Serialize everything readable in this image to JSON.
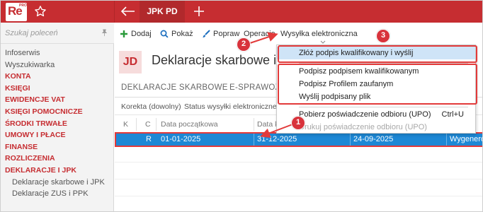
{
  "app": {
    "logo_text": "Re",
    "logo_badge": "PRO",
    "active_tab": "JPK PD"
  },
  "sidebar": {
    "search_placeholder": "Szukaj poleceń",
    "items": [
      {
        "label": "Infoserwis",
        "kind": "plain"
      },
      {
        "label": "Wyszukiwarka",
        "kind": "plain"
      },
      {
        "label": "KONTA",
        "kind": "cat"
      },
      {
        "label": "KSIĘGI",
        "kind": "cat"
      },
      {
        "label": "EWIDENCJE VAT",
        "kind": "cat"
      },
      {
        "label": "KSIĘGI POMOCNICZE",
        "kind": "cat"
      },
      {
        "label": "ŚRODKI TRWAŁE",
        "kind": "cat"
      },
      {
        "label": "UMOWY I PŁACE",
        "kind": "cat"
      },
      {
        "label": "FINANSE",
        "kind": "cat"
      },
      {
        "label": "ROZLICZENIA",
        "kind": "cat"
      },
      {
        "label": "DEKLARACJE I JPK",
        "kind": "cat"
      },
      {
        "label": "Deklaracje skarbowe i JPK",
        "kind": "sub"
      },
      {
        "label": "Deklaracje ZUS i PPK",
        "kind": "sub"
      }
    ]
  },
  "toolbar": {
    "add": "Dodaj",
    "show": "Pokaż",
    "fix": "Popraw",
    "operations": "Operacje",
    "eshipping": "Wysyłka elektroniczna"
  },
  "module": {
    "badge": "JD",
    "title": "Deklaracje skarbowe i JPK",
    "subtabs": [
      "DEKLARACJE SKARBOWE",
      "E-SPRAWOZDANIA"
    ],
    "filters": [
      "Korekta (dowolny)",
      "Status wysyłki elektronicznej"
    ]
  },
  "grid": {
    "columns": [
      "K",
      "C",
      "Data początkowa",
      "Data końcowa"
    ],
    "row": {
      "k": "",
      "c": "R",
      "date_from": "01-01-2025",
      "date_to": "31-12-2025",
      "date_created": "24-09-2025",
      "status": "Wygenerowana"
    }
  },
  "dropdown": {
    "items": [
      {
        "label": "Złóż podpis kwalifikowany i wyślij",
        "state": "hover"
      },
      {
        "label": "Podpisz podpisem kwalifikowanym",
        "state": "normal"
      },
      {
        "label": "Podpisz Profilem zaufanym",
        "state": "normal"
      },
      {
        "label": "Wyślij podpisany plik",
        "state": "normal"
      },
      {
        "label": "Pobierz poświadczenie odbioru (UPO)",
        "state": "normal",
        "shortcut": "Ctrl+U"
      },
      {
        "label": "Drukuj poświadczenie odbioru (UPO)",
        "state": "disabled"
      }
    ]
  },
  "annotations": {
    "step1": "1",
    "step2": "2",
    "step3": "3",
    "color": "#d8333c"
  }
}
